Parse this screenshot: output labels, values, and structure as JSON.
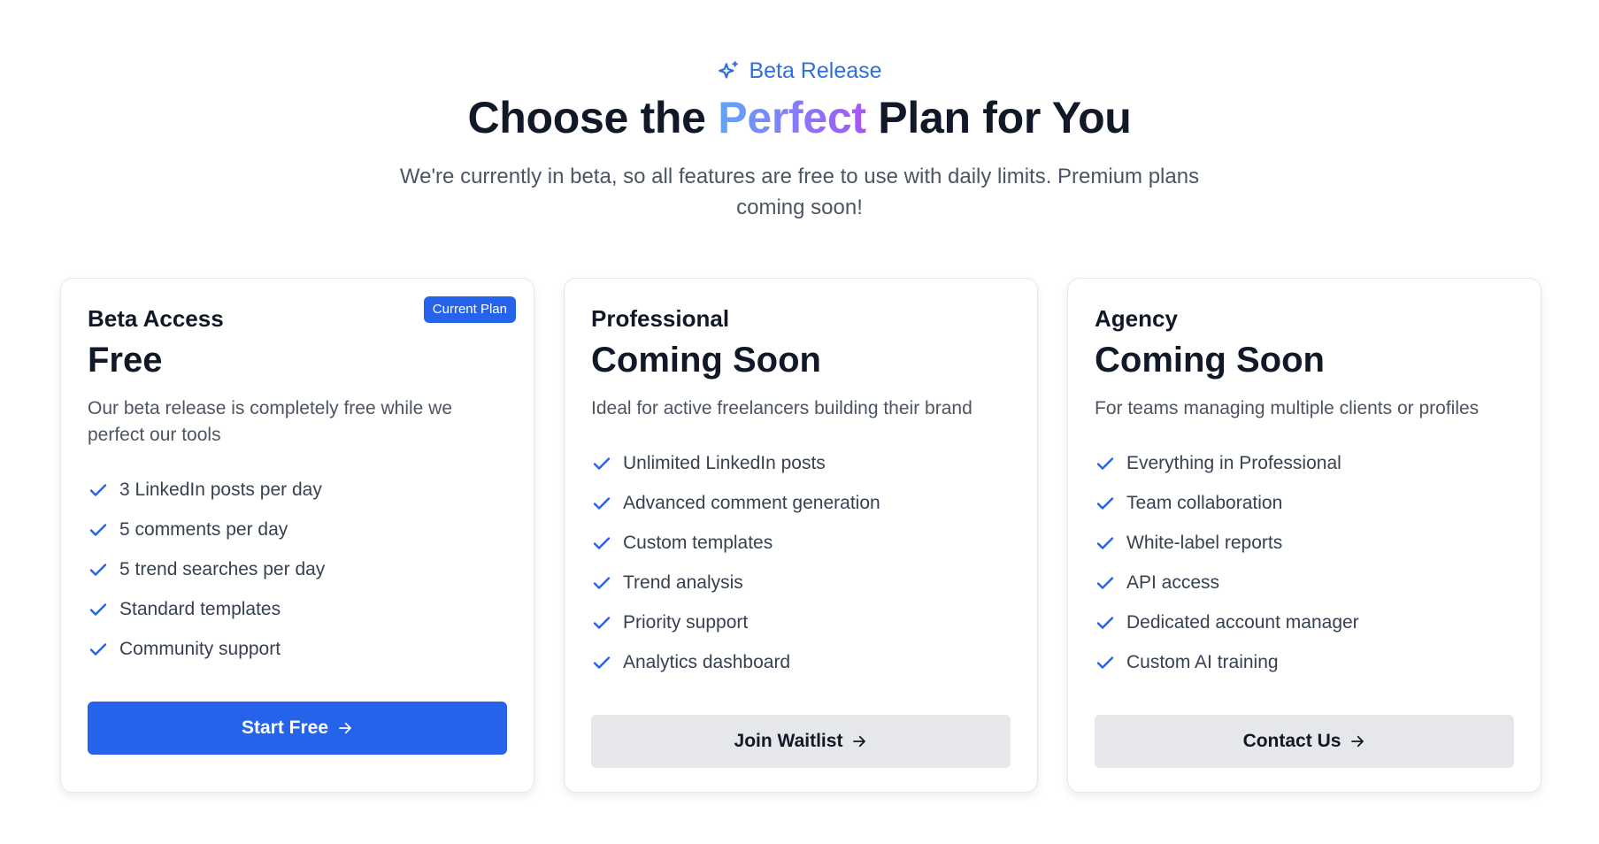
{
  "header": {
    "badge_label": "Beta Release",
    "title_before": "Choose the ",
    "title_highlight": "Perfect",
    "title_after": " Plan for You",
    "subtitle": "We're currently in beta, so all features are free to use with daily limits. Premium plans coming soon!"
  },
  "plans": [
    {
      "name": "Beta Access",
      "price": "Free",
      "description": "Our beta release is completely free while we perfect our tools",
      "badge": "Current Plan",
      "features": [
        "3 LinkedIn posts per day",
        "5 comments per day",
        "5 trend searches per day",
        "Standard templates",
        "Community support"
      ],
      "cta": "Start Free"
    },
    {
      "name": "Professional",
      "price": "Coming Soon",
      "description": "Ideal for active freelancers building their brand",
      "features": [
        "Unlimited LinkedIn posts",
        "Advanced comment generation",
        "Custom templates",
        "Trend analysis",
        "Priority support",
        "Analytics dashboard"
      ],
      "cta": "Join Waitlist"
    },
    {
      "name": "Agency",
      "price": "Coming Soon",
      "description": "For teams managing multiple clients or profiles",
      "features": [
        "Everything in Professional",
        "Team collaboration",
        "White-label reports",
        "API access",
        "Dedicated account manager",
        "Custom AI training"
      ],
      "cta": "Contact Us"
    }
  ],
  "icons": {
    "badge": "sparkles-icon",
    "feature": "check-icon",
    "cta": "arrow-right-icon"
  },
  "colors": {
    "accent": "#2563eb",
    "badge_text": "#2f6fd8",
    "gradient_start": "#60a5fa",
    "gradient_end": "#a855f7"
  }
}
